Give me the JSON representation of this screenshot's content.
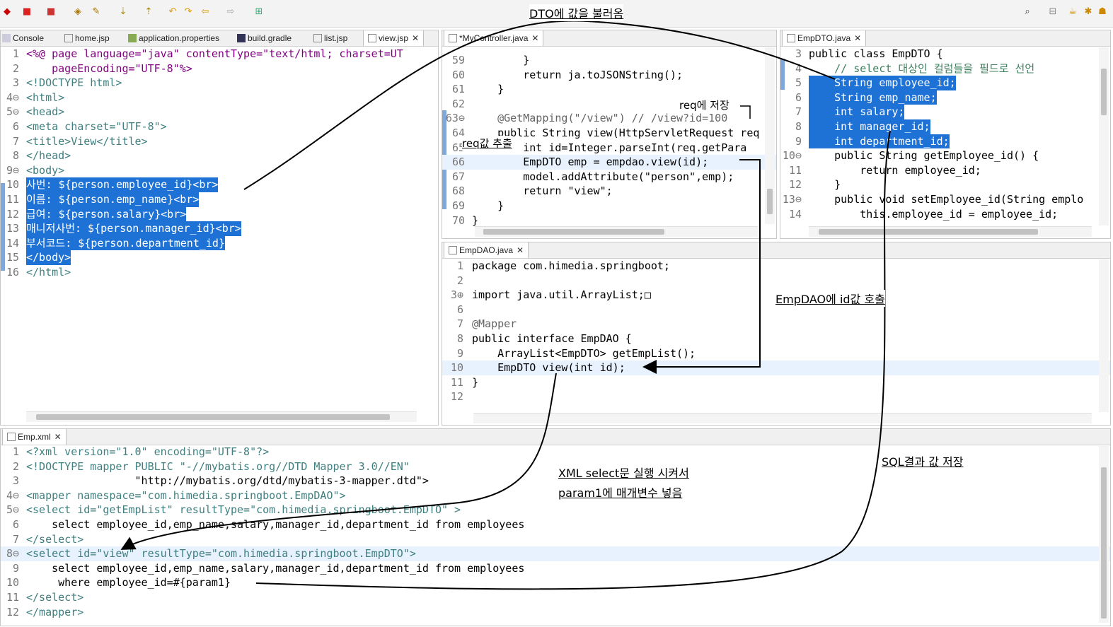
{
  "toolbar": {
    "search_icon": "search-icon"
  },
  "panels": {
    "left": {
      "tabs": [
        {
          "label": "Console",
          "icon": "console-icon"
        },
        {
          "label": "home.jsp",
          "icon": "jsp-file-icon"
        },
        {
          "label": "application.properties",
          "icon": "properties-file-icon"
        },
        {
          "label": "build.gradle",
          "icon": "gradle-file-icon"
        },
        {
          "label": "list.jsp",
          "icon": "jsp-file-icon"
        },
        {
          "label": "view.jsp",
          "icon": "jsp-file-icon",
          "active": true
        }
      ],
      "lines": [
        {
          "n": "1",
          "t": "<%@ page language=\"java\" contentType=\"text/html; charset=UT"
        },
        {
          "n": "2",
          "t": "    pageEncoding=\"UTF-8\"%>"
        },
        {
          "n": "3",
          "t": "<!DOCTYPE html>"
        },
        {
          "n": "4⊖",
          "t": "<html>"
        },
        {
          "n": "5⊖",
          "t": "<head>"
        },
        {
          "n": "6",
          "t": "<meta charset=\"UTF-8\">"
        },
        {
          "n": "7",
          "t": "<title>View</title>"
        },
        {
          "n": "8",
          "t": "</head>"
        },
        {
          "n": "9⊖",
          "t": "<body>"
        },
        {
          "n": "10",
          "t": "사번: ${person.employee_id}<br>"
        },
        {
          "n": "11",
          "t": "이름: ${person.emp_name}<br>"
        },
        {
          "n": "12",
          "t": "급여: ${person.salary}<br>"
        },
        {
          "n": "13",
          "t": "매니저사번: ${person.manager_id}<br>"
        },
        {
          "n": "14",
          "t": "부서코드: ${person.department_id}"
        },
        {
          "n": "15",
          "t": "</body>"
        },
        {
          "n": "16",
          "t": "</html>"
        }
      ]
    },
    "controller": {
      "tabs": [
        {
          "label": "*MyController.java",
          "icon": "java-file-icon",
          "active": true
        }
      ],
      "lines": [
        {
          "n": "59",
          "t": "        }"
        },
        {
          "n": "60",
          "t": "        return ja.toJSONString();"
        },
        {
          "n": "61",
          "t": "    }"
        },
        {
          "n": "62",
          "t": ""
        },
        {
          "n": "63⊖",
          "t": "    @GetMapping(\"/view\") // /view?id=100"
        },
        {
          "n": "64",
          "t": "    public String view(HttpServletRequest req"
        },
        {
          "n": "65",
          "t": "        int id=Integer.parseInt(req.getPara"
        },
        {
          "n": "66",
          "t": "        EmpDTO emp = empdao.view(id);"
        },
        {
          "n": "67",
          "t": "        model.addAttribute(\"person\",emp);"
        },
        {
          "n": "68",
          "t": "        return \"view\";"
        },
        {
          "n": "69",
          "t": "    }"
        },
        {
          "n": "70",
          "t": "}"
        }
      ]
    },
    "dto": {
      "tabs": [
        {
          "label": "EmpDTO.java",
          "icon": "java-file-icon",
          "active": true
        }
      ],
      "lines": [
        {
          "n": "3",
          "t": "public class EmpDTO {"
        },
        {
          "n": "4",
          "t": "    // select 대상인 컬럼들을 필드로 선언"
        },
        {
          "n": "5",
          "t": "    String employee_id;"
        },
        {
          "n": "6",
          "t": "    String emp_name;"
        },
        {
          "n": "7",
          "t": "    int salary;"
        },
        {
          "n": "8",
          "t": "    int manager_id;"
        },
        {
          "n": "9",
          "t": "    int department_id;"
        },
        {
          "n": "10⊖",
          "t": "    public String getEmployee_id() {"
        },
        {
          "n": "11",
          "t": "        return employee_id;"
        },
        {
          "n": "12",
          "t": "    }"
        },
        {
          "n": "13⊖",
          "t": "    public void setEmployee_id(String emplo"
        },
        {
          "n": "14",
          "t": "        this.employee_id = employee_id;"
        }
      ]
    },
    "dao": {
      "tabs": [
        {
          "label": "EmpDAO.java",
          "icon": "java-file-icon",
          "active": true
        }
      ],
      "lines": [
        {
          "n": "1",
          "t": "package com.himedia.springboot;"
        },
        {
          "n": "2",
          "t": ""
        },
        {
          "n": "3⊕",
          "t": "import java.util.ArrayList;□"
        },
        {
          "n": "6",
          "t": ""
        },
        {
          "n": "7",
          "t": "@Mapper"
        },
        {
          "n": "8",
          "t": "public interface EmpDAO {"
        },
        {
          "n": "9",
          "t": "    ArrayList<EmpDTO> getEmpList();"
        },
        {
          "n": "10",
          "t": "    EmpDTO view(int id);"
        },
        {
          "n": "11",
          "t": "}"
        },
        {
          "n": "12",
          "t": ""
        }
      ]
    },
    "xml": {
      "tabs": [
        {
          "label": "Emp.xml",
          "icon": "xml-file-icon",
          "active": true
        }
      ],
      "lines": [
        {
          "n": "1",
          "t": "<?xml version=\"1.0\" encoding=\"UTF-8\"?>"
        },
        {
          "n": "2",
          "t": "<!DOCTYPE mapper PUBLIC \"-//mybatis.org//DTD Mapper 3.0//EN\""
        },
        {
          "n": "3",
          "t": "                 \"http://mybatis.org/dtd/mybatis-3-mapper.dtd\">"
        },
        {
          "n": "4⊖",
          "t": "<mapper namespace=\"com.himedia.springboot.EmpDAO\">"
        },
        {
          "n": "5⊖",
          "t": "<select id=\"getEmpList\" resultType=\"com.himedia.springboot.EmpDTO\" >"
        },
        {
          "n": "6",
          "t": "    select employee_id,emp_name,salary,manager_id,department_id from employees"
        },
        {
          "n": "7",
          "t": "</select>"
        },
        {
          "n": "8⊖",
          "t": "<select id=\"view\" resultType=\"com.himedia.springboot.EmpDTO\">"
        },
        {
          "n": "9",
          "t": "    select employee_id,emp_name,salary,manager_id,department_id from employees"
        },
        {
          "n": "10",
          "t": "     where employee_id=#{param1}"
        },
        {
          "n": "11",
          "t": "</select>"
        },
        {
          "n": "12",
          "t": "</mapper>"
        }
      ]
    }
  },
  "annotations": {
    "dto_load": "DTO에 값을 불러옴",
    "req_store": "req에 저장",
    "req_extract": "req값 추출",
    "dao_call": "EmpDAO에 id값 호출",
    "xml_exec": "XML select문 실행 시켜서",
    "param_put": "param1에 매개변수 넣음",
    "sql_store": "SQL결과 값 저장"
  }
}
